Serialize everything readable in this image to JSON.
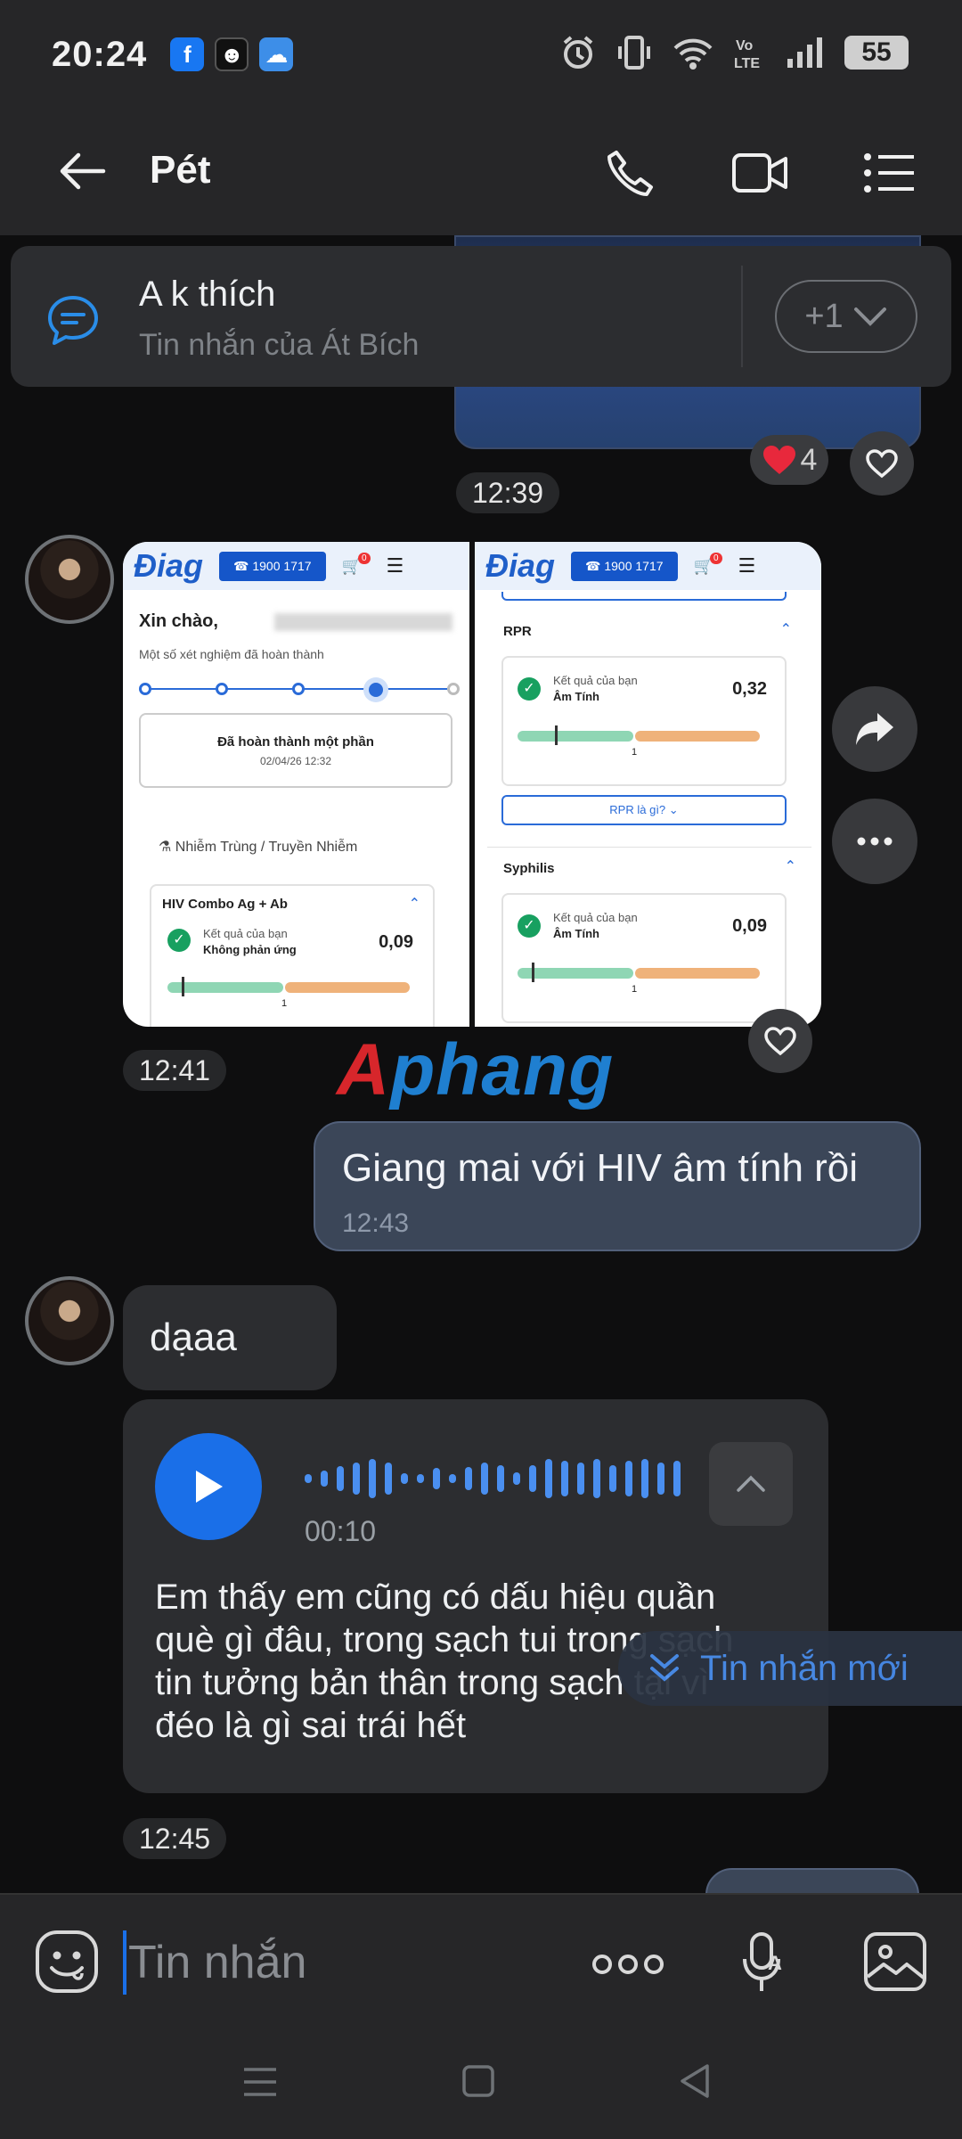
{
  "status_bar": {
    "time": "20:24",
    "battery": "55",
    "app_icons": [
      {
        "name": "facebook-icon",
        "glyph": "f",
        "color": "#1877f2"
      },
      {
        "name": "game-icon",
        "glyph": "☻",
        "color": "#111111"
      },
      {
        "name": "weather-icon",
        "glyph": "☁",
        "color": "#3d8ee8"
      }
    ],
    "system_icons": [
      "alarm-icon",
      "vibrate-icon",
      "wifi-icon",
      "volte-icon",
      "signal-icon",
      "battery-icon"
    ],
    "volte_label": "Vo LTE"
  },
  "header": {
    "title": "Pét"
  },
  "pinned": {
    "title": "A k thích",
    "subtitle": "Tin nhắn của Át Bích",
    "more": "+1"
  },
  "messages": {
    "photo_reaction_count": "4",
    "time_1": "12:39",
    "time_2": "12:41",
    "outgoing_text": "Giang mai với HIV âm tính rồi",
    "outgoing_time": "12:43",
    "incoming_text": "dạaa",
    "voice_duration": "00:10",
    "voice_transcript": "Em thấy em cũng có dấu hiệu quần què gì đâu, trong sạch tui trong sạch tin tưởng bản thân trong sạch tại vì đéo là gì sai trái hết",
    "time_3": "12:45",
    "new_message_label": "Tin nhắn mới"
  },
  "shared_image": {
    "left": {
      "logo": "Điag",
      "phone": "1900 1717",
      "cart_count": "0",
      "greeting": "Xin chào,",
      "intro": "Một số xét nghiệm đã hoàn thành",
      "status": "Đã hoàn thành một phần",
      "date": "02/04/26 12:32",
      "category": "Nhiễm Trùng / Truyền Nhiễm",
      "test_name": "HIV Combo Ag + Ab",
      "result_label": "Kết quả của bạn",
      "result_text": "Không phản ứng",
      "result_value": "0,09",
      "scale_mark": "1"
    },
    "right": {
      "logo": "Điag",
      "phone": "1900 1717",
      "cart_count": "0",
      "test1_name": "RPR",
      "test1_result_label": "Kết quả của bạn",
      "test1_result_text": "Âm Tính",
      "test1_value": "0,32",
      "test1_scale_mark": "1",
      "test1_info": "RPR là gì?",
      "test2_name": "Syphilis",
      "test2_result_label": "Kết quả của bạn",
      "test2_result_text": "Âm Tính",
      "test2_value": "0,09",
      "test2_scale_mark": "1"
    }
  },
  "watermark": {
    "part1": "A",
    "part2": "phang"
  },
  "input": {
    "placeholder": "Tin nhắn"
  },
  "colors": {
    "accent": "#1a6fe8",
    "outgoing_bubble": "#3b4658",
    "incoming_bubble": "#2c2d30",
    "background": "#0e0e0f"
  }
}
